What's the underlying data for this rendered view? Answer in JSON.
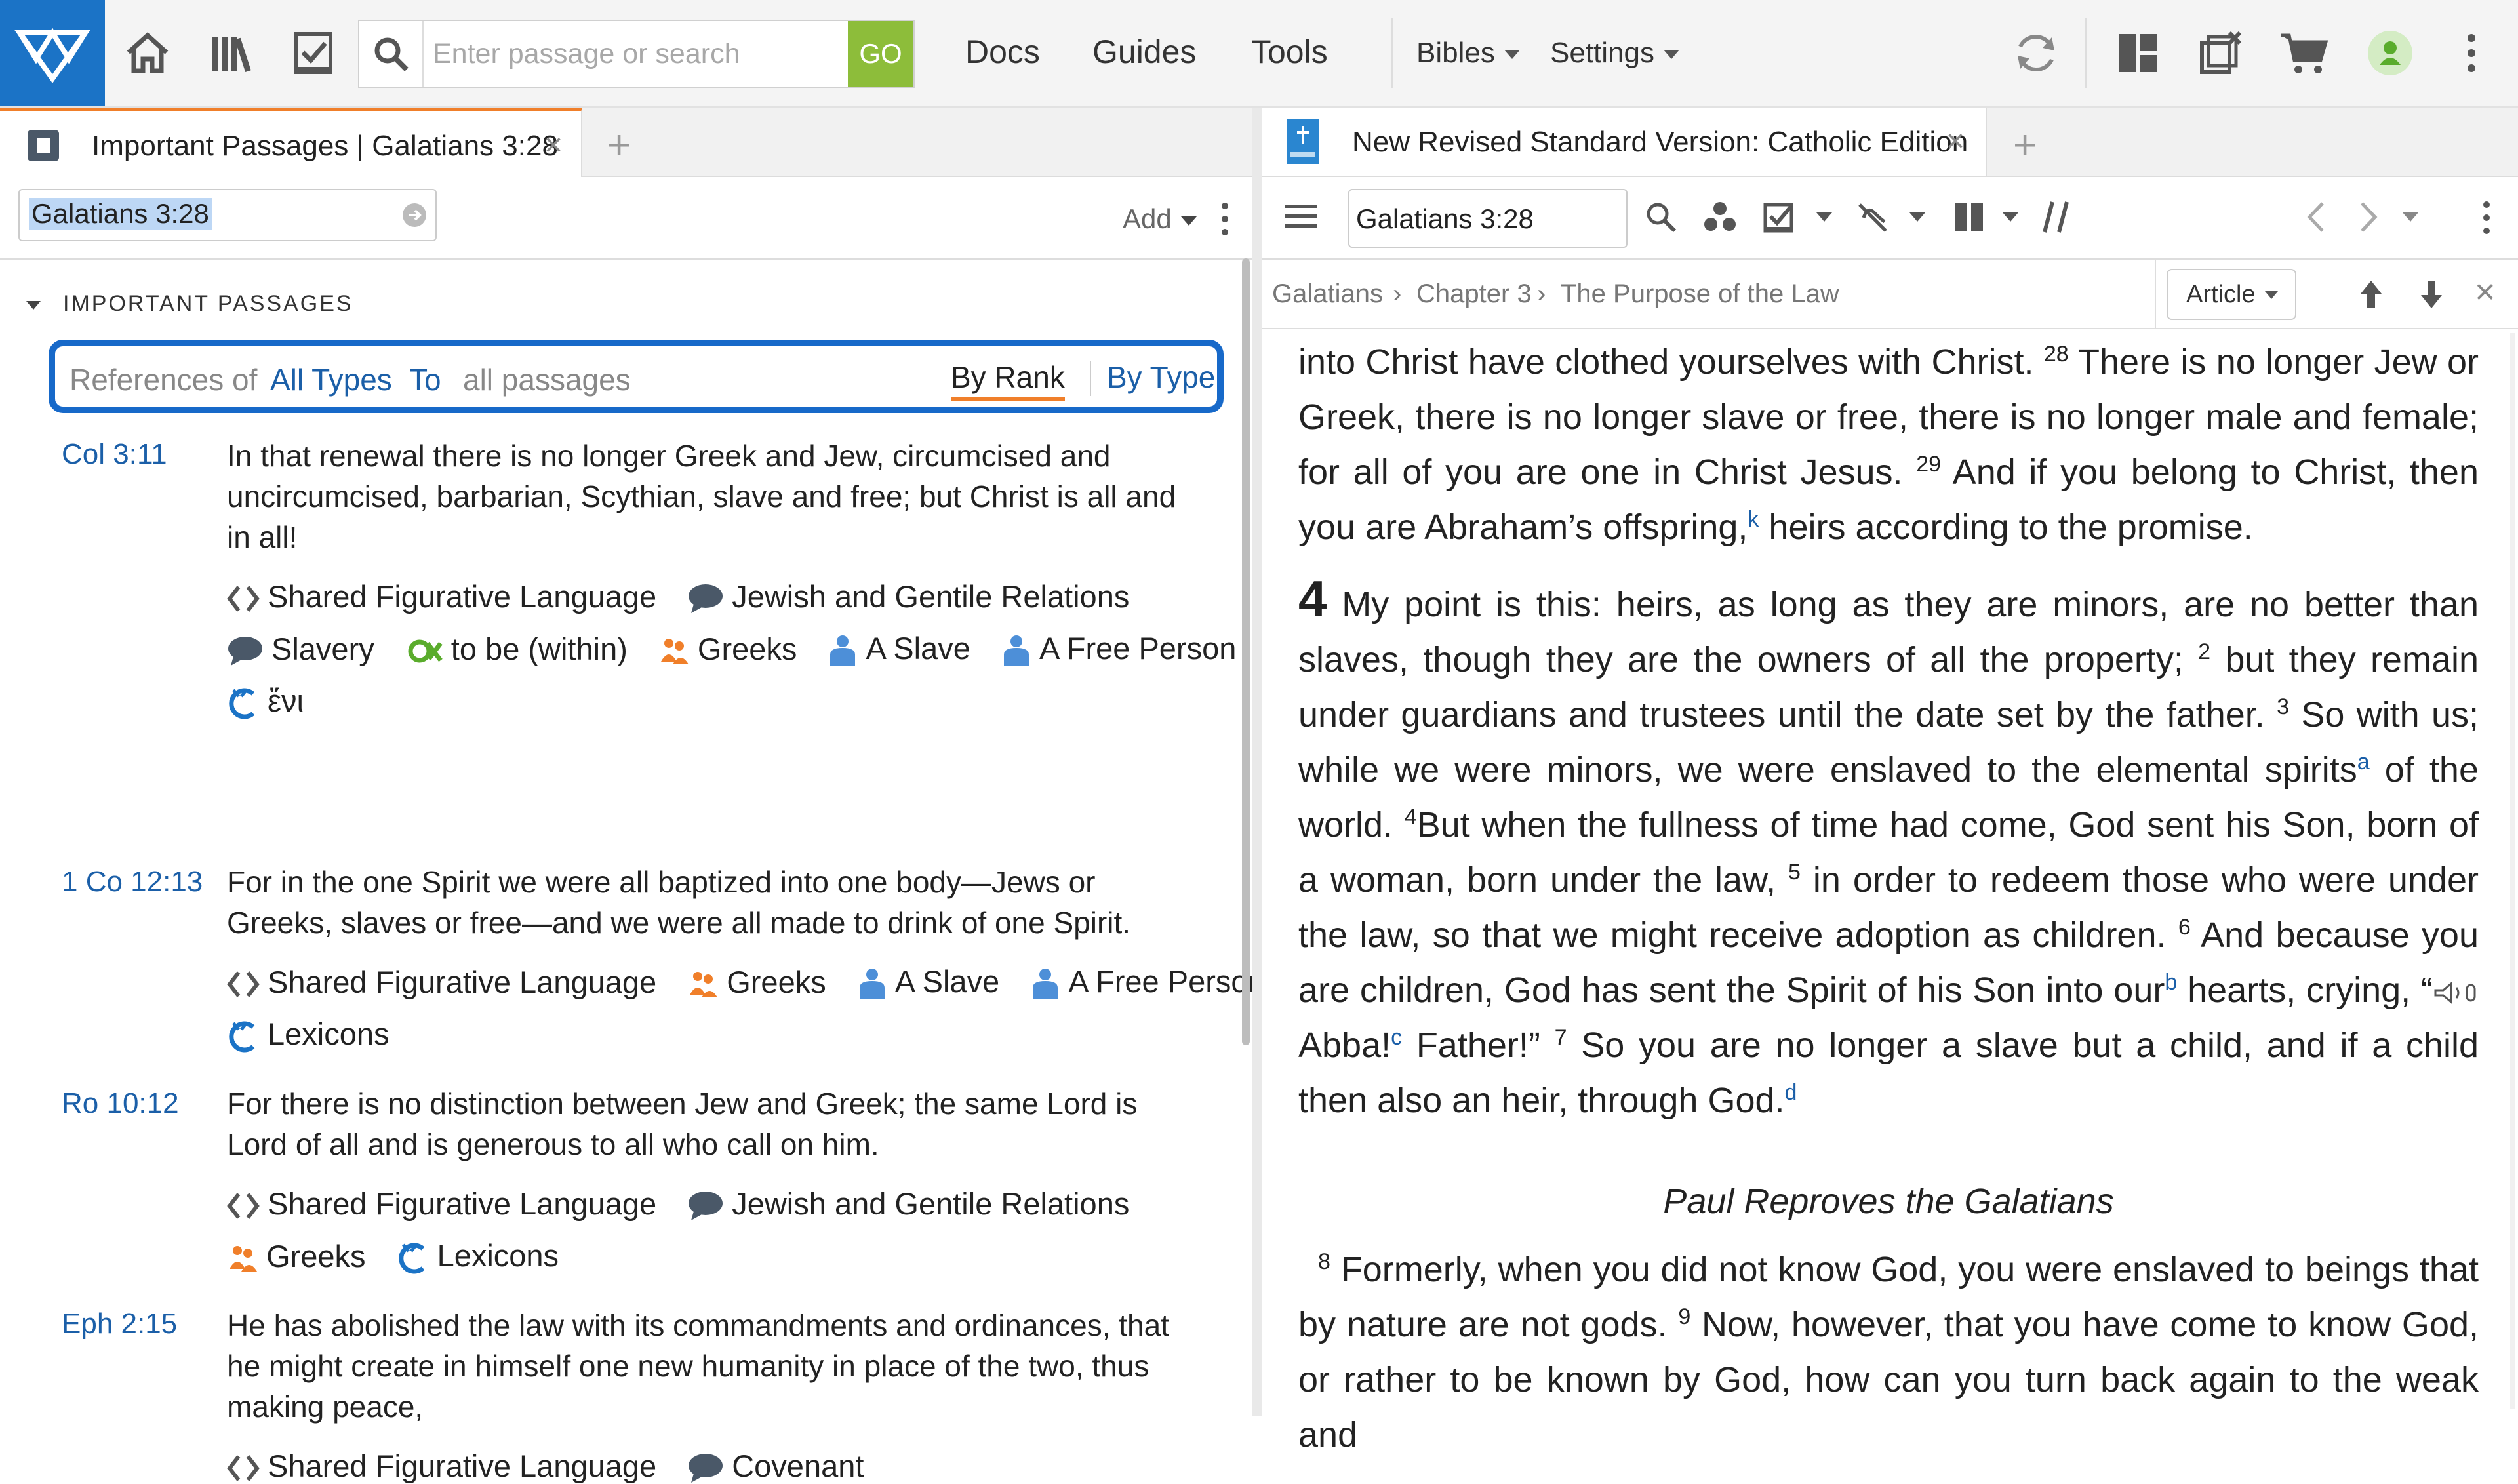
{
  "topbar": {
    "search_placeholder": "Enter passage or search",
    "go_label": "GO",
    "menu": {
      "docs": "Docs",
      "guides": "Guides",
      "tools": "Tools",
      "bibles": "Bibles",
      "settings": "Settings"
    }
  },
  "left_panel": {
    "tab_title": "Important Passages | Galatians 3:28",
    "reference_value": "Galatians 3:28",
    "add_label": "Add",
    "section_title": "IMPORTANT PASSAGES",
    "filter": {
      "references_of": "References of",
      "all_types": "All Types",
      "to": "To",
      "all_passages": "all passages",
      "by_rank": "By Rank",
      "by_type": "By Type"
    },
    "entries": [
      {
        "ref": "Col 3:11",
        "text": "In that renewal there is no longer Greek and Jew, circumcised and uncircumcised, barbarian, Scythian, slave and free; but Christ is all and in all!",
        "tags": [
          "Shared Figurative Language",
          "Jewish and Gentile Relations",
          "Slavery",
          "to be (within)",
          "Greeks",
          "A Slave",
          "A Free Person",
          "ἔνι"
        ]
      },
      {
        "ref": "1 Co 12:13",
        "text": "For in the one Spirit we were all baptized into one body—Jews or Greeks, slaves or free—and we were all made to drink of one Spirit.",
        "tags": [
          "Shared Figurative Language",
          "Greeks",
          "A Slave",
          "A Free Person",
          "Lexicons"
        ]
      },
      {
        "ref": "Ro 10:12",
        "text": "For there is no distinction between Jew and Greek; the same Lord is Lord of all and is generous to all who call on him.",
        "tags": [
          "Shared Figurative Language",
          "Jewish and Gentile Relations",
          "Greeks",
          "Lexicons"
        ]
      },
      {
        "ref": "Eph 2:15",
        "text": "He has abolished the law with its commandments and ordinances, that he might create in himself one new humanity in place of the two, thus making peace,",
        "tags": [
          "Shared Figurative Language",
          "Covenant"
        ]
      }
    ]
  },
  "right_panel": {
    "tab_title": "New Revised Standard Version: Catholic Edition",
    "reference_value": "Galatians 3:28",
    "breadcrumb": [
      "Galatians",
      "Chapter 3",
      "The Purpose of the Law"
    ],
    "article_label": "Article",
    "text": {
      "p1_a": "into Christ have clothed yourselves with Christ. ",
      "v28": "28",
      "p1_b": " There is no longer Jew or Greek, there is no longer slave or free, there is no longer male and female; for all of you are one in Christ Jesus. ",
      "v29": "29",
      "p1_c": " And if you belong to Christ, then you are Abraham’s offspring,",
      "fn_k": "k",
      "p1_d": " heirs according to the promise.",
      "ch4": "4",
      "p2_a": " My point is this: heirs, as long as they are minors, are no better than slaves, though they are the owners of all the property; ",
      "v2": "2",
      "p2_b": " but they remain under guardians and trustees until the date set by the father. ",
      "v3": "3",
      "p2_c": " So with us; while we were minors, we were enslaved to the elemental spirits",
      "fn_a": "a",
      "p2_d": " of the world. ",
      "v4": "4",
      "p2_e": "But when the fullness of time had come, God sent his Son, born of a woman, born under the law, ",
      "v5": "5",
      "p2_f": " in order to redeem those who were under the law, so that we might receive adoption as children. ",
      "v6": "6",
      "p2_g": " And because you are children, God has sent the Spirit of his Son into our",
      "fn_b": "b",
      "p2_h": " hearts, crying, “",
      "p2_i": "Abba!",
      "fn_c": "c",
      "p2_j": " Father!” ",
      "v7": "7",
      "p2_k": " So you are no longer a slave but a child, and if a child then also an heir, through God.",
      "fn_d": "d",
      "heading": "Paul Reproves the Galatians",
      "v8": "8",
      "p3_a": " Formerly, when you did not know God, you were enslaved to beings that by nature are not gods. ",
      "v9": "9",
      "p3_b": " Now, however, that you have come to know God, or rather to be known by God, how can you turn back again to the weak and"
    }
  },
  "colors": {
    "brand_blue": "#1b73c6",
    "go_green": "#8dbd3a",
    "link_blue": "#1b5fa8",
    "highlight_orange": "#f07f2a"
  }
}
